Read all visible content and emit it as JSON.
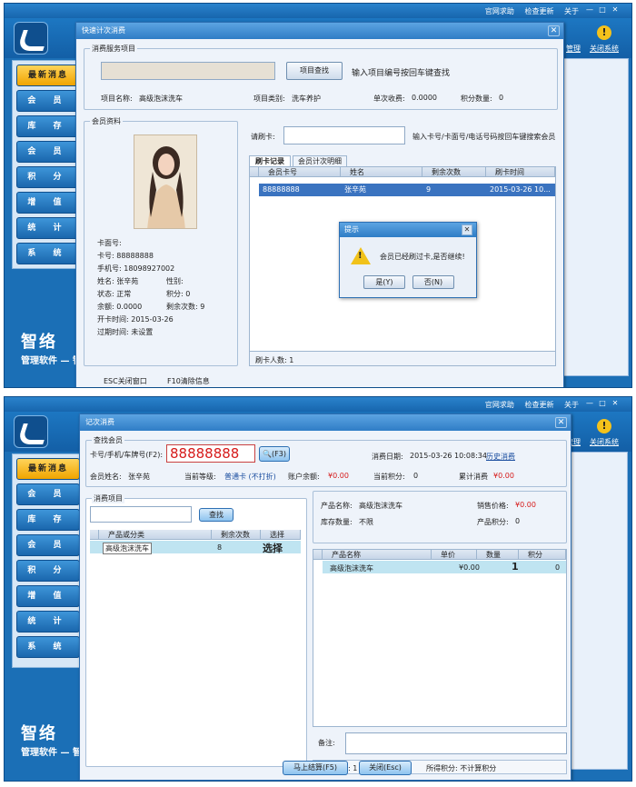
{
  "top": {
    "links": [
      "官网求助",
      "检查更新",
      "关于"
    ],
    "header_labels": [
      "管理",
      "关闭系统"
    ]
  },
  "sidebar": {
    "items": [
      "最新消息",
      "会 员",
      "库 存",
      "会 员",
      "积 分",
      "增 值",
      "统 计",
      "系 统"
    ]
  },
  "brand": {
    "name": "智络",
    "sub": "管理软件 — 智"
  },
  "s1": {
    "title": "快速计次消费",
    "service_group": "消费服务项目",
    "search_btn": "项目查找",
    "search_hint": "输入项目编号按回车键查找",
    "item_name_lbl": "项目名称:",
    "item_name": "高级泡沫洗车",
    "item_type_lbl": "项目类别:",
    "item_type": "洗车养护",
    "single_fee_lbl": "单次收费:",
    "single_fee": "0.0000",
    "points_lbl": "积分数量:",
    "points": "0",
    "member_group": "会员资料",
    "fields": [
      "卡面号:",
      "卡号: 88888888",
      "手机号: 18098927002",
      "姓名: 张辛苑",
      "状态: 正常",
      "余额: 0.0000",
      "开卡时间: 2015-03-26",
      "过期时间: 未设置"
    ],
    "fields_right": [
      "性别:",
      "积分: 0",
      "剩余次数: 9"
    ],
    "swipe_lbl": "请刷卡:",
    "swipe_hint": "输入卡号/卡面号/电话号码按回车键搜索会员",
    "tabs": [
      "刷卡记录",
      "会员计次明细"
    ],
    "grid_head": [
      "会员卡号",
      "姓名",
      "剩余次数",
      "刷卡时间"
    ],
    "grid_row": [
      "88888888",
      "张辛苑",
      "9",
      "2015-03-26 10..."
    ],
    "count_lbl": "刷卡人数: 1",
    "footer": [
      "ESC关闭窗口",
      "F10清除信息"
    ],
    "msg": {
      "title": "提示",
      "text": "会员已经刷过卡,是否继续!",
      "yes": "是(Y)",
      "no": "否(N)"
    }
  },
  "s2": {
    "title": "记次消费",
    "find_group": "查找会员",
    "card_lbl": "卡号/手机/车牌号(F2):",
    "card_value": "88888888",
    "find_btn": "(F3)",
    "date_lbl": "消费日期:",
    "date": "2015-03-26 10:08:34",
    "history": "历史消费",
    "name_lbl": "会员姓名:",
    "name": "张辛苑",
    "level_lbl": "当前等级:",
    "level": "普通卡 (不打折)",
    "balance_lbl": "账户余额:",
    "balance": "¥0.00",
    "cur_points_lbl": "当前积分:",
    "cur_points": "0",
    "total_lbl": "累计消费",
    "total": "¥0.00",
    "item_group": "消费项目",
    "search_btn": "查找",
    "left_head": [
      "产品或分类",
      "剩余次数",
      "选择"
    ],
    "left_row": [
      "高级泡沫洗车",
      "8",
      "选择"
    ],
    "prod_name_lbl": "产品名称:",
    "prod_name": "高级泡沫洗车",
    "sale_price_lbl": "销售价格:",
    "sale_price": "¥0.00",
    "stock_lbl": "库存数量:",
    "stock": "不限",
    "prod_points_lbl": "产品积分:",
    "prod_points": "0",
    "right_head": [
      "产品名称",
      "单价",
      "数量",
      "积分"
    ],
    "right_row": [
      "高级泡沫洗车",
      "¥0.00",
      "1",
      "0"
    ],
    "note_lbl": "备注:",
    "qty_total": "数量合计: 1",
    "earned_points": "所得积分: 不计算积分",
    "checkout": "马上结算(F5)",
    "close": "关闭(Esc)"
  }
}
